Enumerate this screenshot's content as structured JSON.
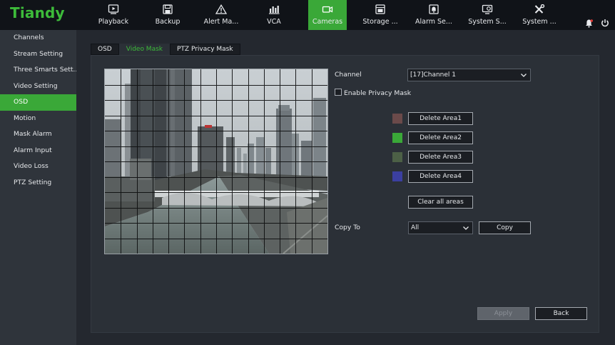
{
  "brand": {
    "logo": "Tiandy",
    "accent": "#3aa838"
  },
  "nav": {
    "items": [
      {
        "label": "Playback",
        "icon": "playback-icon"
      },
      {
        "label": "Backup",
        "icon": "backup-icon"
      },
      {
        "label": "Alert Ma...",
        "icon": "alert-icon"
      },
      {
        "label": "VCA",
        "icon": "vca-icon"
      },
      {
        "label": "Cameras",
        "icon": "camera-icon",
        "active": true
      },
      {
        "label": "Storage ...",
        "icon": "storage-icon"
      },
      {
        "label": "Alarm Se...",
        "icon": "alarm-icon"
      },
      {
        "label": "System S...",
        "icon": "system-status-icon"
      },
      {
        "label": "System ...",
        "icon": "tools-icon"
      }
    ],
    "right_icons": [
      "bell-icon",
      "power-icon"
    ]
  },
  "sidebar": {
    "items": [
      {
        "label": "Channels"
      },
      {
        "label": "Stream Setting"
      },
      {
        "label": "Three Smarts Sett..."
      },
      {
        "label": "Video Setting"
      },
      {
        "label": "OSD",
        "active": true
      },
      {
        "label": "Motion"
      },
      {
        "label": "Mask Alarm"
      },
      {
        "label": "Alarm Input"
      },
      {
        "label": "Video Loss"
      },
      {
        "label": "PTZ Setting"
      }
    ]
  },
  "tabs": [
    {
      "label": "OSD"
    },
    {
      "label": "Video Mask",
      "active": true
    },
    {
      "label": "PTZ Privacy Mask"
    }
  ],
  "form": {
    "channel_label": "Channel",
    "channel_value": "[17]Channel 1",
    "enable_label": "Enable Privacy Mask",
    "enable_checked": false,
    "areas": [
      {
        "label": "Delete Area1",
        "color": "#6b4a4a"
      },
      {
        "label": "Delete Area2",
        "color": "#3aa838"
      },
      {
        "label": "Delete Area3",
        "color": "#4c6046"
      },
      {
        "label": "Delete Area4",
        "color": "#3b3fa0"
      }
    ],
    "clear_label": "Clear all areas",
    "copy_to_label": "Copy To",
    "copy_to_value": "All",
    "copy_label": "Copy"
  },
  "footer": {
    "apply_label": "Apply",
    "back_label": "Back"
  }
}
